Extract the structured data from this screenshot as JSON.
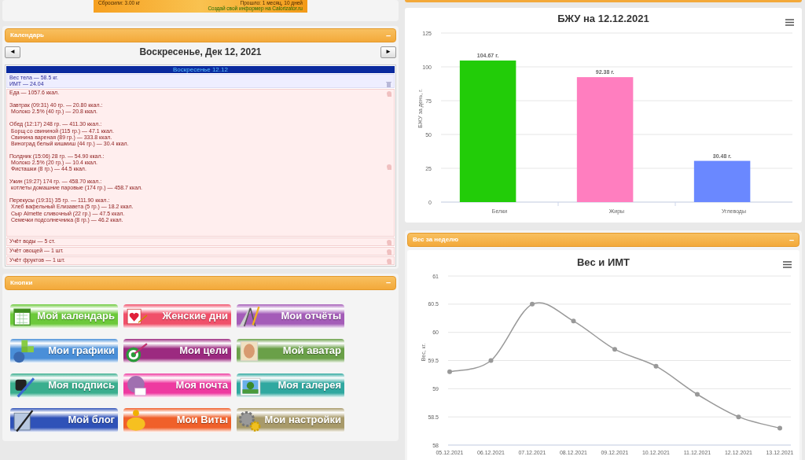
{
  "informer": {
    "lines": [
      "Сбросили: 3.00 кг",
      "Прошло: 1 месяц, 10 дней"
    ],
    "link": "Создай свой информер на Calorizator.ru"
  },
  "calendar": {
    "title": "Календарь",
    "collapse": "–",
    "prev": "◄",
    "next": "►",
    "date_heading": "Воскресенье, Дек 12, 2021",
    "day_header": "Воскресенье 12.12",
    "entries": [
      {
        "kind": "weight",
        "lines": [
          "Вес тела — 58.5 кг.",
          "ИМТ — 24.04"
        ]
      },
      {
        "kind": "food",
        "title": "Еда — 1057.6 ккал.",
        "meals": [
          {
            "title": "Завтрак (09:31) 40 гр. — 20.80 ккал.:",
            "items": [
              "Молоко 2.5% (40 гр.) — 20.8 ккал."
            ]
          },
          {
            "title": "Обед (12:17) 248 гр. — 411.30 ккал.:",
            "items": [
              "Борщ со свининой (115 гр.) — 47.1 ккал.",
              "Свинина вареная (89 гр.) — 333.8 ккал.",
              "Виноград белый кишмиш (44 гр.) — 30.4 ккал."
            ]
          },
          {
            "title": "Полдник (15:06) 28 гр. — 54.90 ккал.:",
            "items": [
              "Молоко 2.5% (20 гр.) — 10.4 ккал.",
              "Фисташки (8 гр.) — 44.5 ккал."
            ]
          },
          {
            "title": "Ужин (19:27) 174 гр. — 458.70 ккал.:",
            "items": [
              "котлеты домашние паровые (174 гр.) — 458.7 ккал."
            ]
          },
          {
            "title": "Перекусы (19:31) 35 гр. — 111.90 ккал.:",
            "items": [
              "Хлеб вафельный Елизавета (5 гр.) — 18.2 ккал.",
              "Сыр Almette сливочный (22 гр.) — 47.5 ккал.",
              "Семечки подсолнечника (8 гр.) — 46.2 ккал."
            ]
          }
        ]
      },
      {
        "kind": "count",
        "lines": [
          "Учёт воды — 5 ст."
        ]
      },
      {
        "kind": "count",
        "lines": [
          "Учёт овощей — 1 шт."
        ]
      },
      {
        "kind": "count",
        "lines": [
          "Учёт фруктов — 1 шт."
        ]
      }
    ]
  },
  "buttons_panel": {
    "title": "Кнопки",
    "collapse": "–",
    "buttons": [
      {
        "label": "Мой календарь",
        "color": "#6cc93a",
        "kind": "calendar"
      },
      {
        "label": "Женские дни",
        "color": "#f0506a",
        "kind": "heart"
      },
      {
        "label": "Мои отчёты",
        "color": "#a45cb8",
        "kind": "compass"
      },
      {
        "label": "Мои графики",
        "color": "#4a8fd8",
        "kind": "cubes"
      },
      {
        "label": "Мои цели",
        "color": "#9c2a80",
        "kind": "target"
      },
      {
        "label": "Мой аватар",
        "color": "#6aa048",
        "kind": "portrait"
      },
      {
        "label": "Моя подпись",
        "color": "#3aae8e",
        "kind": "pen"
      },
      {
        "label": "Моя почта",
        "color": "#ee3aa0",
        "kind": "mail"
      },
      {
        "label": "Моя галерея",
        "color": "#30a8a0",
        "kind": "photo"
      },
      {
        "label": "Мой блог",
        "color": "#2f52b8",
        "kind": "blog"
      },
      {
        "label": "Мои Виты",
        "color": "#f0602a",
        "kind": "piggy"
      },
      {
        "label": "Мои настройки",
        "color": "#a89a6a",
        "kind": "gears"
      }
    ]
  },
  "bju_panel": {
    "chart_data": {
      "type": "bar",
      "title": "БЖУ на 12.12.2021",
      "ylabel": "БЖУ за день, г.",
      "categories": [
        "Белки",
        "Жиры",
        "Углеводы"
      ],
      "values": [
        104.67,
        92.38,
        30.48
      ],
      "colors": [
        "#22cc08",
        "#ff7ebf",
        "#6a88ff"
      ],
      "grid": true,
      "ylim": [
        0,
        125
      ],
      "yticks": [
        0,
        25,
        50,
        75,
        100,
        125
      ],
      "value_labels": [
        "104.67 г.",
        "92.38 г.",
        "30.48 г."
      ]
    }
  },
  "weight_panel": {
    "title": "Вес за неделю",
    "collapse": "–",
    "chart_data": {
      "type": "line",
      "title": "Вес и ИМТ",
      "ylabel": "Вес, кг.",
      "categories": [
        "05.12.2021",
        "06.12.2021",
        "07.12.2021",
        "08.12.2021",
        "09.12.2021",
        "10.12.2021",
        "11.12.2021",
        "12.12.2021",
        "13.12.2021"
      ],
      "values": [
        59.3,
        59.5,
        60.5,
        60.2,
        59.7,
        59.4,
        58.9,
        58.5,
        58.3
      ],
      "grid": true,
      "marker": true,
      "ylim": [
        58,
        61
      ],
      "yticks": [
        58,
        58.5,
        59,
        59.5,
        60,
        60.5,
        61
      ]
    }
  }
}
